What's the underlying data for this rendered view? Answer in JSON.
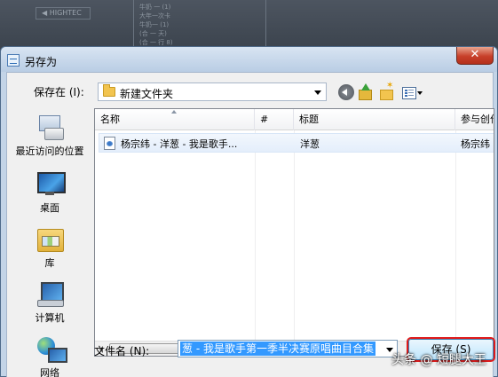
{
  "background": {
    "button_label": "◀ HIGHTEC",
    "list_lines": [
      "牛奶 一 (1)",
      "大年一次卡",
      "牛奶一 (1)",
      "(合 一 天)",
      "(合 一 行 8)"
    ]
  },
  "dialog": {
    "title": "另存为",
    "close_label": "✕",
    "save_in_label": "保存在 (I):",
    "save_in_value": "新建文件夹",
    "places": [
      {
        "label": "最近访问的位置",
        "icon": "recent-places-icon"
      },
      {
        "label": "桌面",
        "icon": "desktop-icon"
      },
      {
        "label": "库",
        "icon": "libraries-icon"
      },
      {
        "label": "计算机",
        "icon": "computer-icon"
      },
      {
        "label": "网络",
        "icon": "network-icon"
      }
    ],
    "columns": [
      "名称",
      "#",
      "标题",
      "参与创作"
    ],
    "files": [
      {
        "name": "杨宗纬 - 洋葱 - 我是歌手...",
        "number": "",
        "title": "洋葱",
        "artist": "杨宗纬"
      }
    ],
    "scrollbar_grip": "III",
    "filename_label": "文件名 (N):",
    "filename_value": "葱 - 我是歌手第一季半决赛原唱曲目合集",
    "save_button": "保存 (S)"
  },
  "watermark": "头条 @ 短腿大王"
}
